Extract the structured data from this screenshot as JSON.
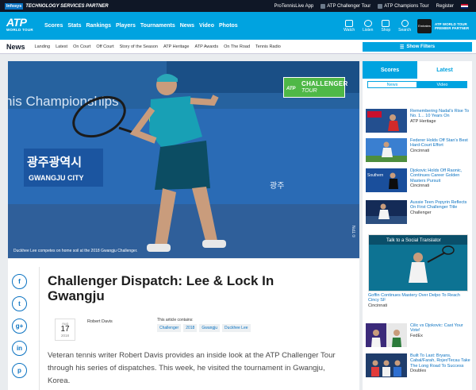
{
  "topbar": {
    "infosys": "Infosys",
    "partner": "TECHNOLOGY SERVICES PARTNER",
    "links": [
      "ProTennisLive App",
      "ATP Challenger Tour",
      "ATP Champions Tour",
      "Register"
    ]
  },
  "brand": {
    "logo_main": "ATP",
    "logo_sub": "WORLD TOUR"
  },
  "nav": {
    "items": [
      "Scores",
      "Stats",
      "Rankings",
      "Players",
      "Tournaments",
      "News",
      "Video",
      "Photos"
    ],
    "icons": [
      "Watch",
      "Listen",
      "Shop",
      "Search"
    ]
  },
  "sponsor": {
    "name": "Emirates",
    "tagline": "ATP WORLD TOUR PREMIER PARTNER"
  },
  "subnav": {
    "section": "News",
    "items": [
      "Landing",
      "Latest",
      "On Court",
      "Off Court",
      "Story of the Season",
      "ATP Heritage",
      "ATP Awards",
      "On The Road",
      "Tennis Radio"
    ],
    "filters": "Show Filters"
  },
  "hero": {
    "caption": "Duckhee Lee competes on home soil at the 2018 Gwangju Challenger.",
    "badge_line1": "CHALLENGER",
    "badge_line2": "TOUR",
    "badge_atp": "ATP",
    "banner_text": "nis Championships",
    "sign_korean": "광주광역시",
    "sign_city": "GWANGJU CITY",
    "photo_credit": "© TPN"
  },
  "article": {
    "title": "Challenger Dispatch: Lee & Lock In Gwangju",
    "date": {
      "month": "Aug",
      "day": "17",
      "year": "2018"
    },
    "author": "Robert Davis",
    "contains_label": "This article contains:",
    "tags": [
      "Challenger",
      "2018",
      "Gwangju",
      "Duckhee Lee"
    ],
    "body": "Veteran tennis writer Robert Davis provides an inside look at the ATP Challenger Tour through his series of dispatches. This week, he visited the tournament in Gwangju, Korea."
  },
  "social": [
    "f",
    "t",
    "g+",
    "in",
    "p"
  ],
  "sidebar": {
    "tabs": [
      "Scores",
      "Latest"
    ],
    "subtabs": [
      "News",
      "Video"
    ],
    "items": [
      {
        "title": "Remembering Nadal's Rise To No. 1... 10 Years On",
        "category": "ATP Heritage"
      },
      {
        "title": "Federer Holds Off Stan's Best Hard-Court Effort",
        "category": "Cincinnati"
      },
      {
        "title": "Djokovic Holds Off Raonic, Continues Career Golden Masters Pursuit",
        "category": "Cincinnati"
      },
      {
        "title": "Aussie Teen Popyrin Reflects On First Challenger Title",
        "category": "Challenger"
      }
    ],
    "big_item": {
      "title": "Goffin Continues Mastery Over Delpo To Reach Cincy SF",
      "category": "Cincinnati",
      "thumb_caption": "Talk to a Social Translator"
    },
    "items2": [
      {
        "title": "Cilic vs Djokovic: Cast Your Vote!",
        "category": "FedEx"
      },
      {
        "title": "Built To Last: Bryans, Cabal/Farah, Rojer/Tecau Take The Long Road To Success",
        "category": "Doubles"
      }
    ]
  },
  "colors": {
    "accent": "#00a3e0",
    "navy": "#0f1726",
    "link": "#0a72c1",
    "challenger_green": "#4fb847"
  }
}
